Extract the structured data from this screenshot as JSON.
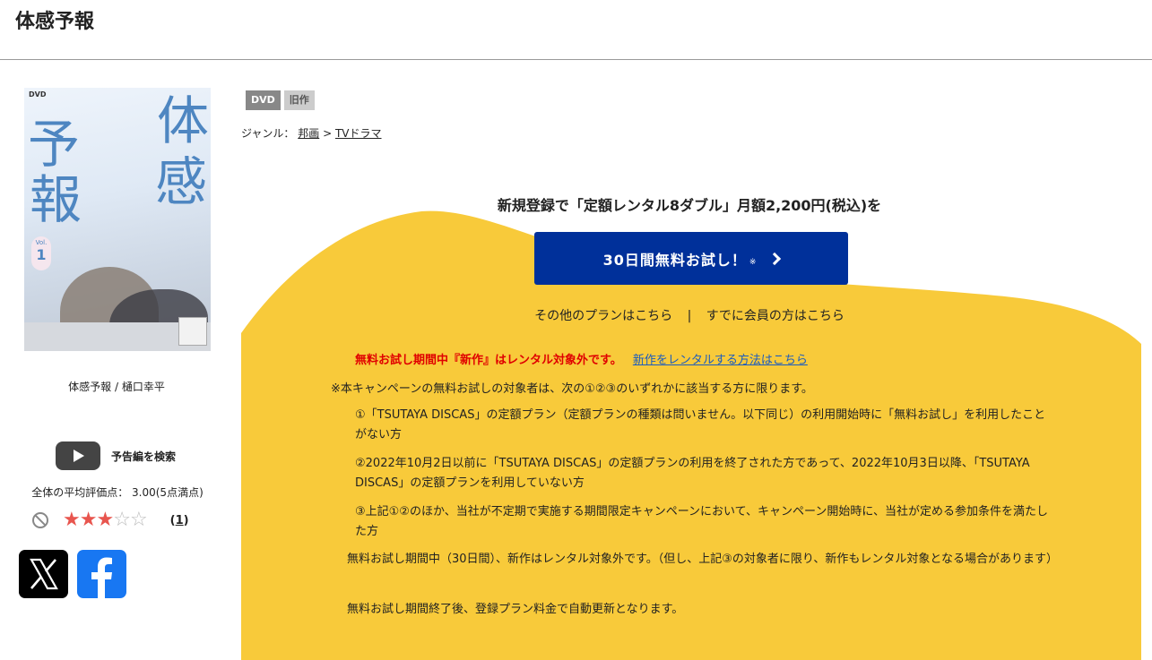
{
  "page": {
    "title": "体感予報"
  },
  "cover": {
    "dvd_mark": "DVD",
    "chars": [
      "体",
      "感",
      "予",
      "報"
    ],
    "vol_label": "Vol.",
    "vol_number": "1"
  },
  "product": {
    "caption": "体感予報 / 樋口幸平"
  },
  "trailer": {
    "label": "予告編を検索"
  },
  "rating": {
    "average_text": "全体の平均評価点： 3.00(5点満点)",
    "value": 3,
    "max": 5,
    "review_count": "1"
  },
  "tags": [
    "DVD",
    "旧作"
  ],
  "genre": {
    "prefix": "ジャンル：",
    "items": [
      "邦画",
      "TVドラマ"
    ],
    "separator": ">"
  },
  "promo": {
    "headline": "新規登録で「定額レンタル8ダブル」月額2,200円(税込)を",
    "cta_label": "30日間無料お試し！",
    "cta_note": "※",
    "other_plans": "その他のプランはこちら",
    "link_separator": "|",
    "member_link": "すでに会員の方はこちら",
    "notice_red": "無料お試し期間中『新作』はレンタル対象外です。",
    "notice_link": "新作をレンタルする方法はこちら",
    "terms_intro": "※本キャンペーンの無料お試しの対象者は、次の①②③のいずれかに該当する方に限ります。",
    "conditions": [
      "①「TSUTAYA DISCAS」の定額プラン（定額プランの種類は問いません。以下同じ）の利用開始時に「無料お試し」を利用したことがない方",
      "②2022年10月2日以前に「TSUTAYA DISCAS」の定額プランの利用を終了された方であって、2022年10月3日以降、「TSUTAYA DISCAS」の定額プランを利用していない方",
      "③上記①②のほか、当社が不定期で実施する期間限定キャンペーンにおいて、キャンペーン開始時に、当社が定める参加条件を満たした方"
    ],
    "note_1": "無料お試し期間中（30日間）、新作はレンタル対象外です。（但し、上記③の対象者に限り、新作もレンタル対象となる場合があります）",
    "note_2": "無料お試し期間終了後、登録プラン料金で自動更新となります。"
  },
  "colors": {
    "promo_bg": "#f8ca3a",
    "cta_bg": "#00309a",
    "notice_red": "#e00000",
    "link_blue": "#1a5bbf",
    "star": "#e8554e"
  }
}
